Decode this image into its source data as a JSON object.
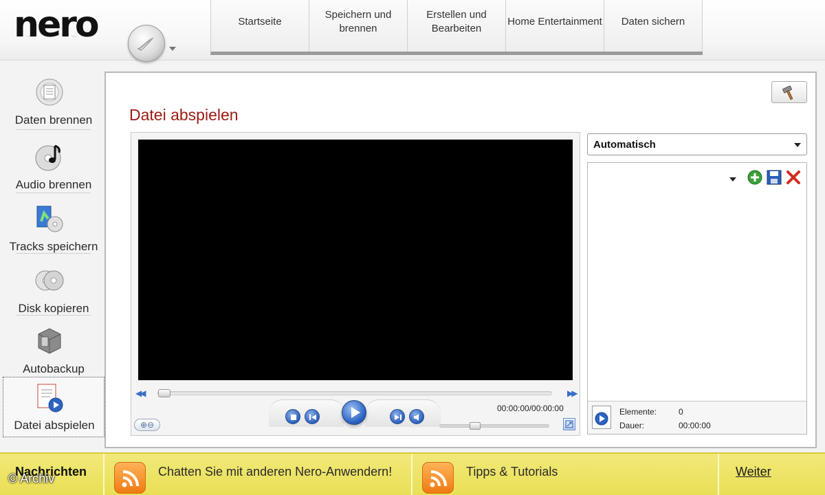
{
  "header": {
    "logo": "nero",
    "tabs": [
      {
        "label": "Startseite"
      },
      {
        "label": "Speichern und brennen"
      },
      {
        "label": "Erstellen und Bearbeiten"
      },
      {
        "label": "Home Entertainment"
      },
      {
        "label": "Daten sichern"
      }
    ]
  },
  "sidebar": {
    "items": [
      {
        "label": "Daten brennen",
        "icon": "data-disc-icon"
      },
      {
        "label": "Audio brennen",
        "icon": "audio-disc-icon"
      },
      {
        "label": "Tracks speichern",
        "icon": "rip-tracks-icon"
      },
      {
        "label": "Disk kopieren",
        "icon": "copy-disc-icon"
      },
      {
        "label": "Autobackup",
        "icon": "autobackup-icon"
      },
      {
        "label": "Datei abspielen",
        "icon": "play-file-icon",
        "active": true
      }
    ]
  },
  "main": {
    "title": "Datei abspielen",
    "player": {
      "timecode": "00:00:00/00:00:00",
      "seek_position": 0.0,
      "volume_level": 0.3
    },
    "playlist": {
      "mode_select": "Automatisch",
      "elements_label": "Elemente:",
      "elements_value": "0",
      "duration_label": "Dauer:",
      "duration_value": "00:00:00"
    }
  },
  "newsbar": {
    "heading": "Nachrichten",
    "item1": "Chatten Sie mit anderen Nero-Anwendern!",
    "item2": "Tipps & Tutorials",
    "more": "Weiter"
  },
  "watermark": "© Archiv",
  "colors": {
    "title_red": "#9b1b12",
    "news_yellow": "#ece25f",
    "rss_orange": "#f28a1e",
    "player_blue": "#2d63c2"
  }
}
